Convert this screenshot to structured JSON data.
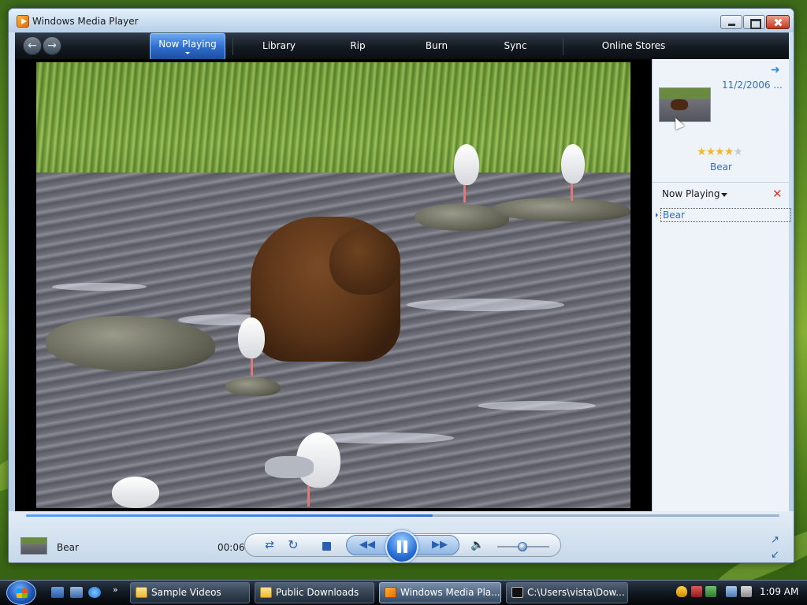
{
  "window": {
    "title": "Windows Media Player"
  },
  "nav": {
    "tabs": [
      {
        "label": "Now Playing"
      },
      {
        "label": "Library"
      },
      {
        "label": "Rip"
      },
      {
        "label": "Burn"
      },
      {
        "label": "Sync"
      },
      {
        "label": "Online Stores"
      }
    ]
  },
  "pane": {
    "date": "11/2/2006 ...",
    "title": "Bear",
    "rating_stars": 4,
    "list_header": "Now Playing",
    "playlist": [
      {
        "label": "Bear"
      }
    ]
  },
  "controls": {
    "now_playing_title": "Bear",
    "time": "00:06",
    "seek_progress": 0.54,
    "volume_level": 0.48
  },
  "taskbar": {
    "tasks": [
      {
        "label": "Sample Videos",
        "icon": "folder-icon"
      },
      {
        "label": "Public Downloads",
        "icon": "folder-icon"
      },
      {
        "label": "Windows Media Pla...",
        "icon": "wmp-icon"
      },
      {
        "label": "C:\\Users\\vista\\Dow...",
        "icon": "cmd-icon"
      }
    ],
    "clock": "1:09 AM"
  },
  "colors": {
    "accent": "#2f6fd0",
    "link": "#2f6fc4",
    "clear": "#d23a2a"
  }
}
